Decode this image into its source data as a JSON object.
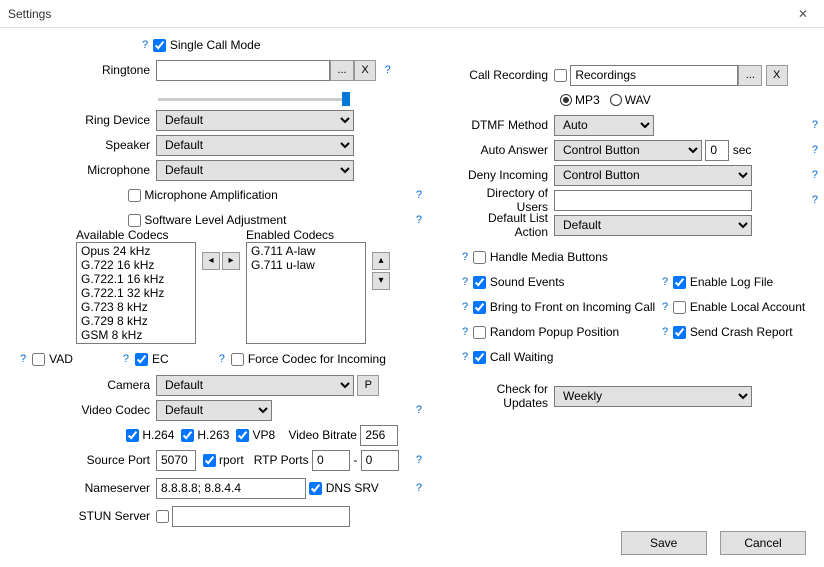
{
  "window": {
    "title": "Settings"
  },
  "left": {
    "singleCallMode": "Single Call Mode",
    "ringtone": {
      "label": "Ringtone",
      "value": ""
    },
    "ringDevice": {
      "label": "Ring Device",
      "value": "Default"
    },
    "speaker": {
      "label": "Speaker",
      "value": "Default"
    },
    "microphone": {
      "label": "Microphone",
      "value": "Default"
    },
    "micAmp": "Microphone Amplification",
    "swLevel": "Software Level Adjustment",
    "availableCodecsLabel": "Available Codecs",
    "enabledCodecsLabel": "Enabled Codecs",
    "availableCodecs": [
      "Opus 24 kHz",
      "G.722 16 kHz",
      "G.722.1 16 kHz",
      "G.722.1 32 kHz",
      "G.723 8 kHz",
      "G.729 8 kHz",
      "GSM 8 kHz"
    ],
    "enabledCodecs": [
      "G.711 A-law",
      "G.711 u-law"
    ],
    "vad": "VAD",
    "ec": "EC",
    "forceCodec": "Force Codec for Incoming",
    "camera": {
      "label": "Camera",
      "value": "Default"
    },
    "previewBtn": "P",
    "videoCodec": {
      "label": "Video Codec",
      "value": "Default"
    },
    "h264": "H.264",
    "h263": "H.263",
    "vp8": "VP8",
    "videoBitrate": {
      "label": "Video Bitrate",
      "value": "256"
    },
    "sourcePort": {
      "label": "Source Port",
      "value": "5070"
    },
    "rport": "rport",
    "rtpPorts": {
      "label": "RTP Ports",
      "from": "0",
      "to": "0"
    },
    "nameserver": {
      "label": "Nameserver",
      "value": "8.8.8.8; 8.8.4.4"
    },
    "dnssrv": "DNS SRV",
    "stun": {
      "label": "STUN Server",
      "value": ""
    }
  },
  "right": {
    "callRecording": {
      "label": "Call Recording",
      "value": "Recordings"
    },
    "mp3": "MP3",
    "wav": "WAV",
    "dtmf": {
      "label": "DTMF Method",
      "value": "Auto"
    },
    "autoAnswer": {
      "label": "Auto Answer",
      "value": "Control Button",
      "delay": "0",
      "sec": "sec"
    },
    "deny": {
      "label": "Deny Incoming",
      "value": "Control Button"
    },
    "dirUsers": {
      "label": "Directory of Users",
      "value": ""
    },
    "defList": {
      "label": "Default List Action",
      "value": "Default"
    },
    "handleMedia": "Handle Media Buttons",
    "soundEvents": "Sound Events",
    "bringFront": "Bring to Front on Incoming Call",
    "randomPopup": "Random Popup Position",
    "callWaiting": "Call Waiting",
    "enableLog": "Enable Log File",
    "enableLocal": "Enable Local Account",
    "sendCrash": "Send Crash Report",
    "checkUpdates": {
      "label": "Check for Updates",
      "value": "Weekly"
    }
  },
  "footer": {
    "save": "Save",
    "cancel": "Cancel"
  },
  "misc": {
    "browse": "...",
    "clear": "X",
    "dash": "-"
  }
}
